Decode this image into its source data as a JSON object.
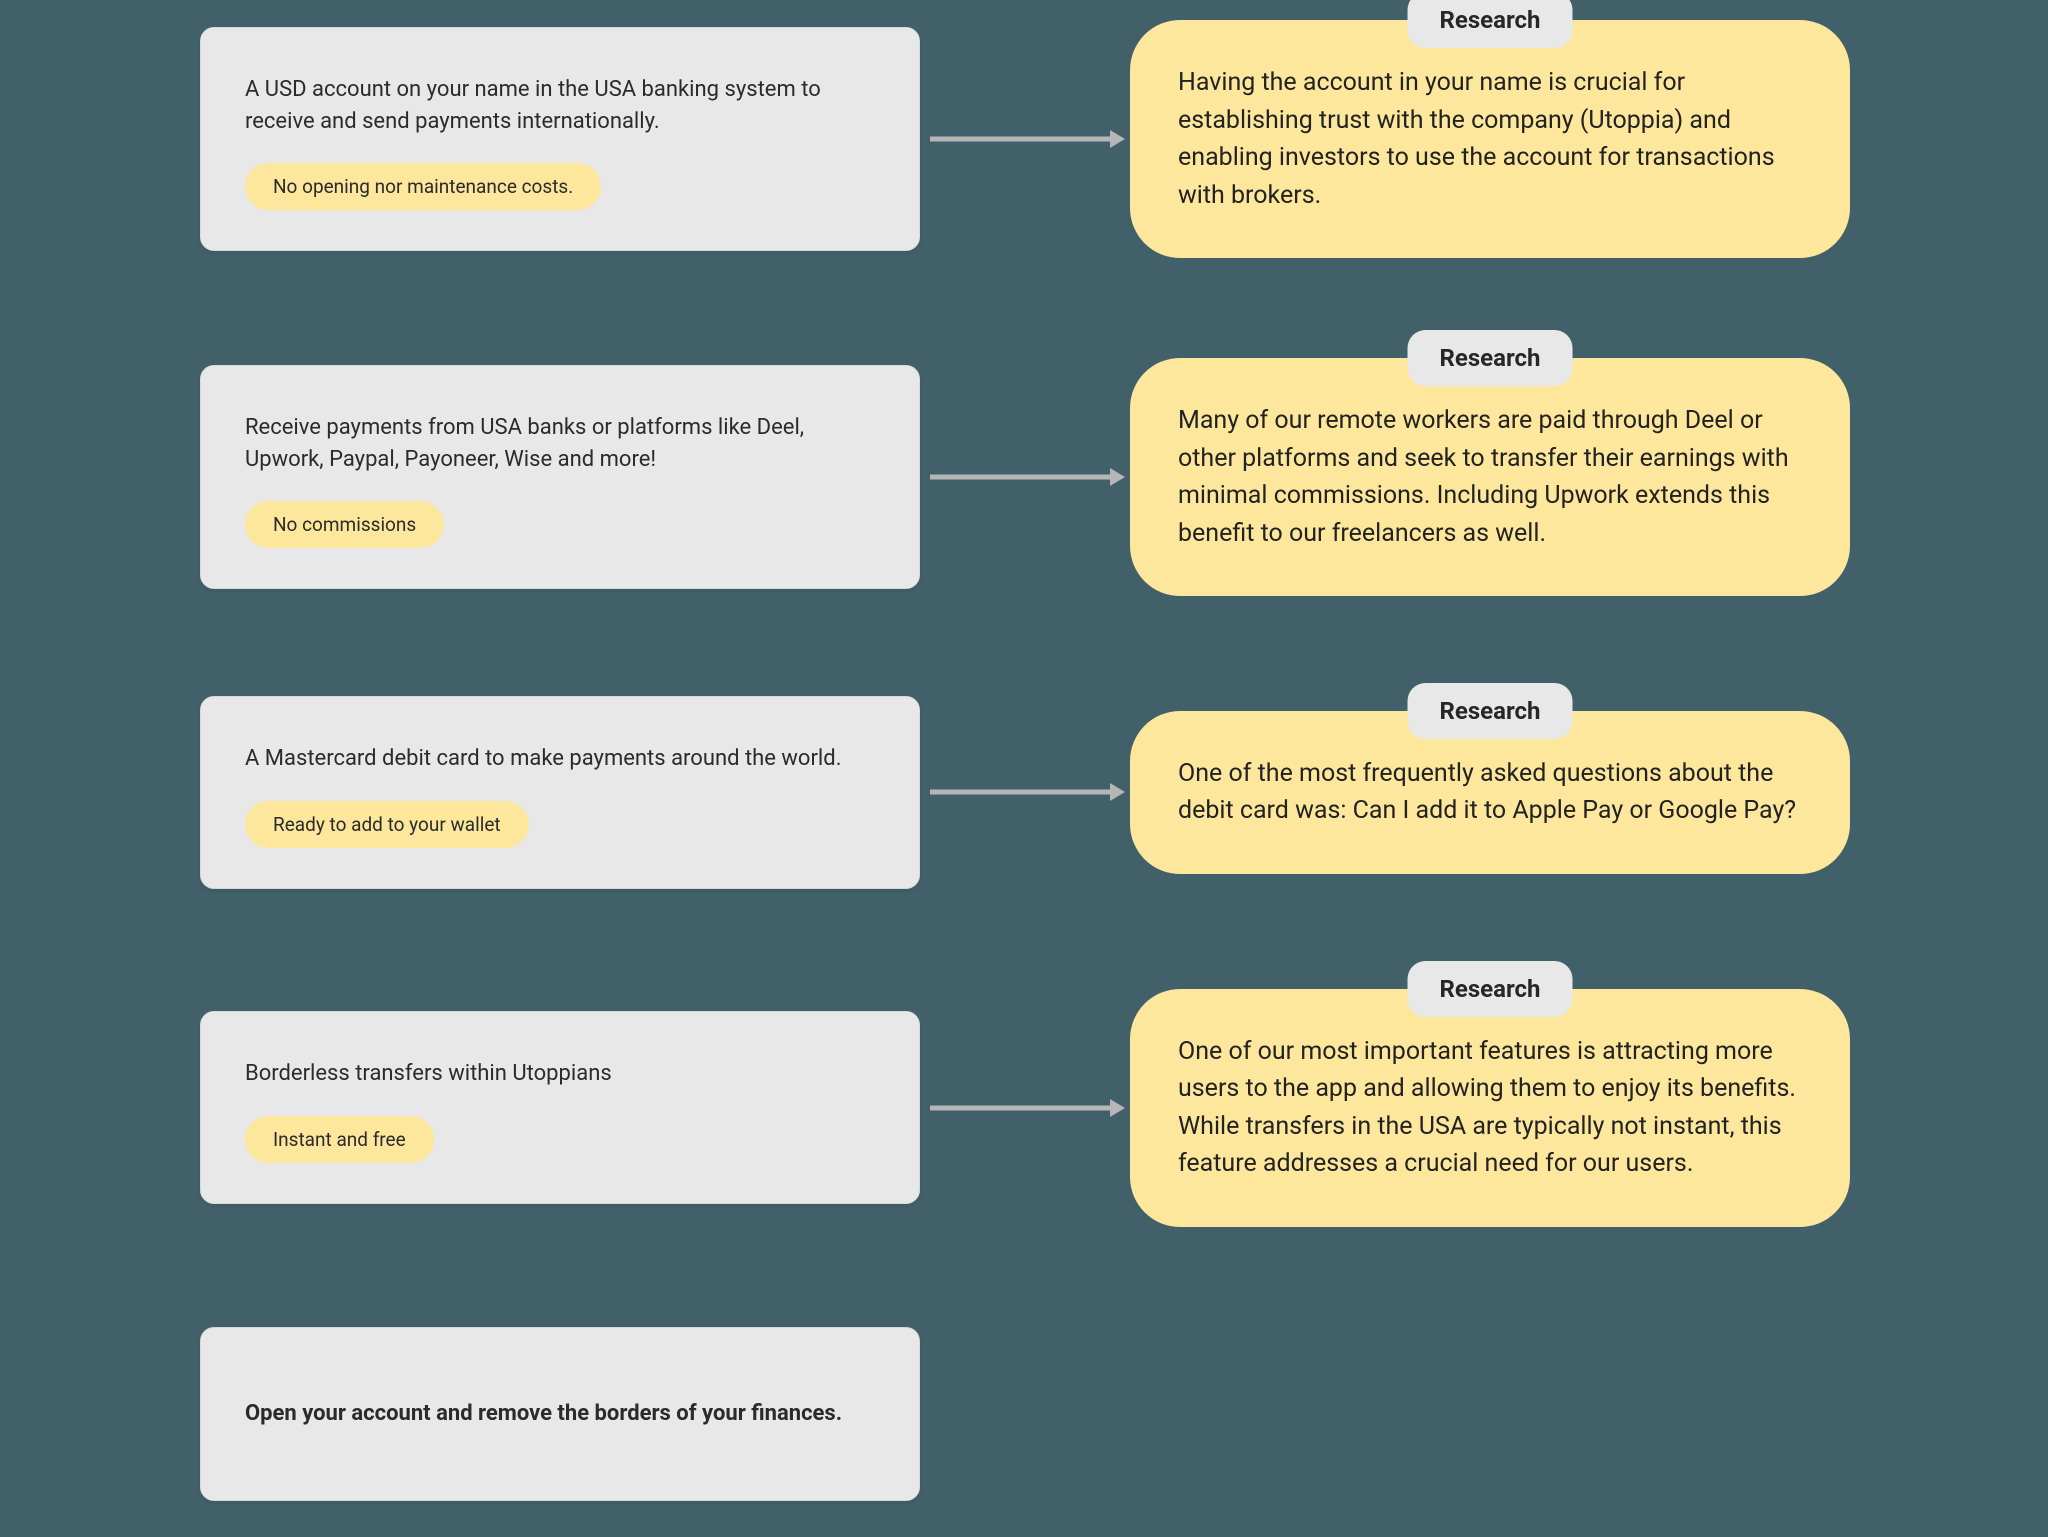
{
  "research_tag": "Research",
  "rows": [
    {
      "feature": {
        "desc": "A USD account on your name in the USA banking system to receive and send payments internationally.",
        "pill": "No opening nor maintenance costs."
      },
      "research": "Having the account in your name is crucial for establishing trust with the company (Utoppia) and enabling investors to use the account for transactions with brokers."
    },
    {
      "feature": {
        "desc": "Receive payments from USA banks or platforms like Deel, Upwork, Paypal, Payoneer, Wise and more!",
        "pill": "No commissions"
      },
      "research": "Many of our remote workers are paid through Deel or other platforms and seek to transfer their earnings with minimal commissions. Including Upwork extends this benefit to our freelancers as well."
    },
    {
      "feature": {
        "desc": "A Mastercard debit card to make payments around the world.",
        "pill": "Ready to add to your wallet"
      },
      "research": "One of the most frequently asked questions about the debit card was: Can I add it to Apple Pay or Google Pay?"
    },
    {
      "feature": {
        "desc": "Borderless transfers within Utoppians",
        "pill": "Instant and free"
      },
      "research": "One of our most important features is attracting more users to the app and allowing them to enjoy its benefits. While transfers in the USA are typically not instant, this feature addresses a crucial need for our users."
    }
  ],
  "cta": {
    "desc": "Open your account and remove the borders of your finances."
  }
}
